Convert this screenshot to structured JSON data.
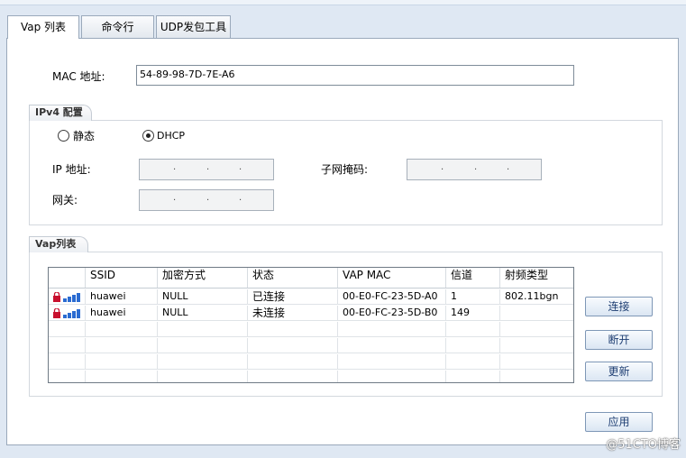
{
  "tabs": [
    {
      "label": "Vap 列表",
      "active": true
    },
    {
      "label": "命令行",
      "active": false
    },
    {
      "label": "UDP发包工具",
      "active": false
    }
  ],
  "mac": {
    "label": "MAC 地址:",
    "value": "54-89-98-7D-7E-A6"
  },
  "ipv4": {
    "title": "IPv4 配置",
    "static_label": "静态",
    "dhcp_label": "DHCP",
    "selected": "dhcp",
    "ip_label": "IP 地址:",
    "mask_label": "子网掩码:",
    "gateway_label": "网关:",
    "ip_dots": [
      ".",
      ".",
      "."
    ]
  },
  "vap": {
    "title": "Vap列表",
    "columns": [
      "SSID",
      "加密方式",
      "状态",
      "VAP MAC",
      "信道",
      "射频类型"
    ],
    "rows": [
      {
        "ssid": "huawei",
        "enc": "NULL",
        "status": "已连接",
        "mac": "00-E0-FC-23-5D-A0",
        "channel": "1",
        "radio": "802.11bgn"
      },
      {
        "ssid": "huawei",
        "enc": "NULL",
        "status": "未连接",
        "mac": "00-E0-FC-23-5D-B0",
        "channel": "149",
        "radio": ""
      }
    ],
    "connect_label": "连接",
    "disconnect_label": "断开",
    "refresh_label": "更新"
  },
  "apply_label": "应用",
  "watermark": "@51CTO博客",
  "colors": {
    "accent": "#1f3f73",
    "lock": "#c8102e",
    "signal": "#2a6bd1"
  }
}
